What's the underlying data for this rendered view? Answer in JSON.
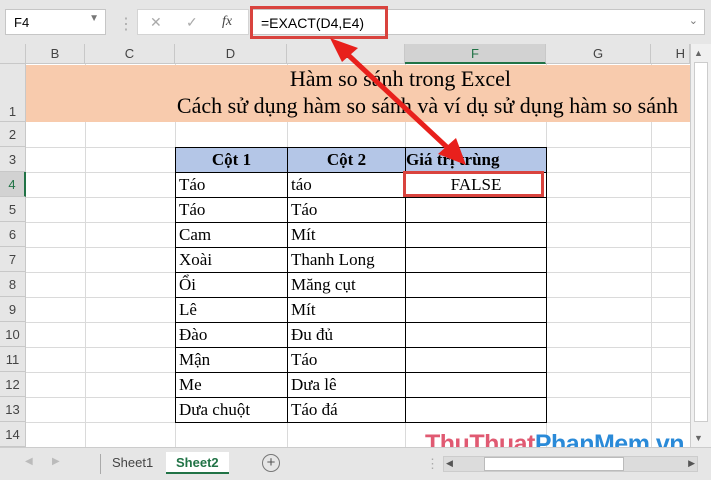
{
  "formula_bar": {
    "name_box": "F4",
    "cancel_icon": "✕",
    "enter_icon": "✓",
    "fx_label": "fx",
    "formula": "=EXACT(D4,E4)"
  },
  "columns": [
    "B",
    "C",
    "D",
    "E",
    "F",
    "G",
    "H"
  ],
  "rows": [
    "1",
    "2",
    "3",
    "4",
    "5",
    "6",
    "7",
    "8",
    "9",
    "10",
    "11",
    "12",
    "13",
    "14"
  ],
  "title": {
    "line1": "Hàm so sánh trong Excel",
    "line2": "Cách sử dụng hàm so sánh và ví dụ sử dụng hàm so sánh"
  },
  "table": {
    "headers": [
      "Cột 1",
      "Cột 2",
      "Giá trị trùng"
    ],
    "rows": [
      [
        "Táo",
        "táo",
        "FALSE"
      ],
      [
        "Táo",
        "Táo",
        ""
      ],
      [
        "Cam",
        "Mít",
        ""
      ],
      [
        "Xoài",
        "Thanh Long",
        ""
      ],
      [
        "Ổi",
        "Măng cụt",
        ""
      ],
      [
        "Lê",
        "Mít",
        ""
      ],
      [
        "Đào",
        "Đu đủ",
        ""
      ],
      [
        "Mận",
        "Táo",
        ""
      ],
      [
        "Me",
        "Dưa lê",
        ""
      ],
      [
        "Dưa chuột",
        "Táo đá",
        ""
      ]
    ]
  },
  "sheets": [
    "Sheet1",
    "Sheet2"
  ],
  "active_sheet": "Sheet2",
  "watermark": {
    "part1": "ThuThuat",
    "part2": "PhanMem.vn"
  },
  "colors": {
    "highlight": "#d9433e",
    "accent": "#217346",
    "title_bg": "#f8cbad",
    "header_bg": "#b4c6e7"
  }
}
